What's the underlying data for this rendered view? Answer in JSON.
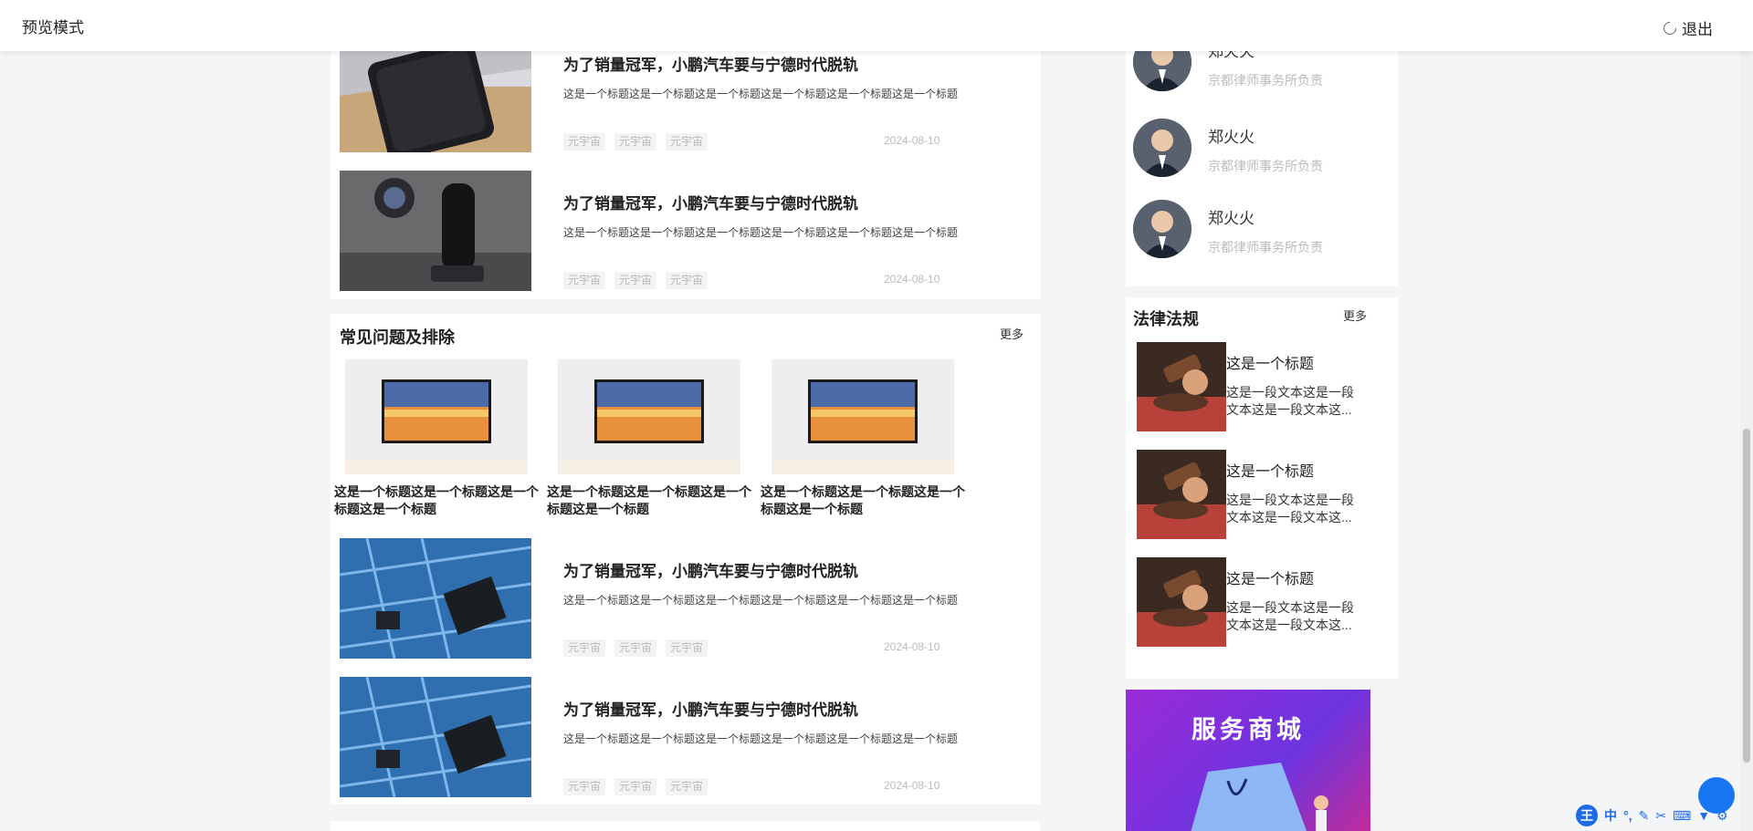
{
  "topbar": {
    "title": "预览模式",
    "exit_label": "退出"
  },
  "news_top": [
    {
      "title": "为了销量冠军，小鹏汽车要与宁德时代脱轨",
      "desc": "这是一个标题这是一个标题这是一个标题这是一个标题这是一个标题这是一个标题",
      "tags": [
        "元宇宙",
        "元宇宙",
        "元宇宙"
      ],
      "date": "2024-08-10"
    },
    {
      "title": "为了销量冠军，小鹏汽车要与宁德时代脱轨",
      "desc": "这是一个标题这是一个标题这是一个标题这是一个标题这是一个标题这是一个标题",
      "tags": [
        "元宇宙",
        "元宇宙",
        "元宇宙"
      ],
      "date": "2024-08-10"
    }
  ],
  "faq": {
    "title": "常见问题及排除",
    "more": "更多",
    "cards": [
      {
        "text": "这是一个标题这是一个标题这是一个标题这是一个标题"
      },
      {
        "text": "这是一个标题这是一个标题这是一个标题这是一个标题"
      },
      {
        "text": "这是一个标题这是一个标题这是一个标题这是一个标题"
      }
    ],
    "news": [
      {
        "title": "为了销量冠军，小鹏汽车要与宁德时代脱轨",
        "desc": "这是一个标题这是一个标题这是一个标题这是一个标题这是一个标题这是一个标题",
        "tags": [
          "元宇宙",
          "元宇宙",
          "元宇宙"
        ],
        "date": "2024-08-10"
      },
      {
        "title": "为了销量冠军，小鹏汽车要与宁德时代脱轨",
        "desc": "这是一个标题这是一个标题这是一个标题这是一个标题这是一个标题这是一个标题",
        "tags": [
          "元宇宙",
          "元宇宙",
          "元宇宙"
        ],
        "date": "2024-08-10"
      }
    ]
  },
  "lawyers": [
    {
      "name": "郑火火",
      "desc": "京都律师事务所负责"
    },
    {
      "name": "郑火火",
      "desc": "京都律师事务所负责"
    },
    {
      "name": "郑火火",
      "desc": "京都律师事务所负责"
    }
  ],
  "laws": {
    "title": "法律法规",
    "more": "更多",
    "items": [
      {
        "title": "这是一个标题",
        "desc": "这是一段文本这是一段文本这是一段文本这..."
      },
      {
        "title": "这是一个标题",
        "desc": "这是一段文本这是一段文本这是一段文本这..."
      },
      {
        "title": "这是一个标题",
        "desc": "这是一段文本这是一段文本这是一段文本这..."
      }
    ]
  },
  "banner": {
    "text": "服务商城"
  },
  "ime": {
    "badge": "王",
    "mode": "中",
    "punct": "°,"
  }
}
